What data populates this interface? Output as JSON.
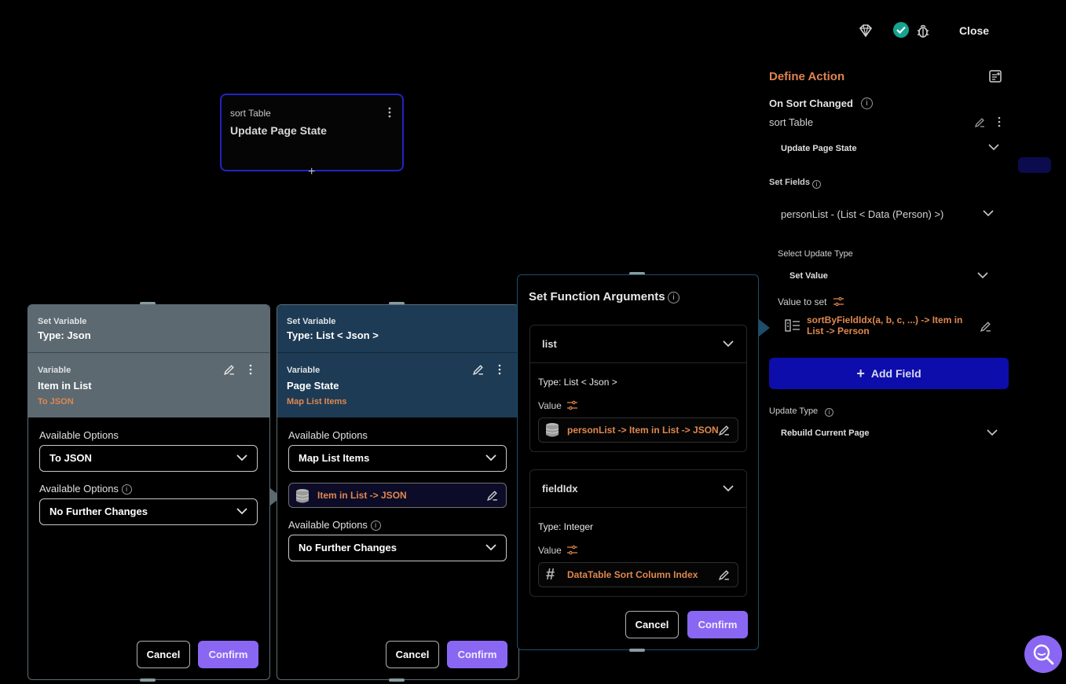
{
  "topbar": {
    "close_label": "Close"
  },
  "action_node": {
    "subtitle": "sort Table",
    "title": "Update Page State"
  },
  "right_panel": {
    "title": "Define Action",
    "trigger": "On Sort Changed",
    "action_name": "sort Table",
    "action_type": "Update Page State",
    "set_fields_label": "Set Fields",
    "field_selected": "personList - (List < Data (Person) >)",
    "update_type_label": "Select Update Type",
    "update_type_value": "Set Value",
    "value_to_set_label": "Value to set",
    "value_expr": "sortByFieldIdx(a, b, c, ...) -> Item in List -> Person",
    "add_field_label": "Add Field",
    "page_update_type_label": "Update Type",
    "page_update_type_value": "Rebuild Current Page"
  },
  "panel1": {
    "set_var_label": "Set Variable",
    "type_label": "Type: Json",
    "variable_label": "Variable",
    "variable_name": "Item in List",
    "transform": "To JSON",
    "options_label_1": "Available Options",
    "option_1": "To JSON",
    "options_label_2": "Available Options",
    "option_2": "No Further Changes",
    "cancel": "Cancel",
    "confirm": "Confirm"
  },
  "panel2": {
    "set_var_label": "Set Variable",
    "type_label": "Type: List < Json >",
    "variable_label": "Variable",
    "variable_name": "Page State",
    "transform": "Map List Items",
    "options_label_1": "Available Options",
    "option_1": "Map List Items",
    "chip": "Item in List -> JSON",
    "options_label_2": "Available Options",
    "option_2": "No Further Changes",
    "cancel": "Cancel",
    "confirm": "Confirm"
  },
  "function_args": {
    "title": "Set Function Arguments",
    "args": [
      {
        "name": "list",
        "type": "Type: List < Json >",
        "value_label": "Value",
        "value": "personList -> Item in List -> JSON"
      },
      {
        "name": "fieldIdx",
        "type": "Type: Integer",
        "value_label": "Value",
        "value": "DataTable Sort Column Index"
      }
    ],
    "cancel": "Cancel",
    "confirm": "Confirm"
  },
  "colors": {
    "accent_orange": "#e0874f",
    "primary_purple": "#8a67f2",
    "add_field_blue": "#0d0dab",
    "node_border": "#2323c4"
  }
}
